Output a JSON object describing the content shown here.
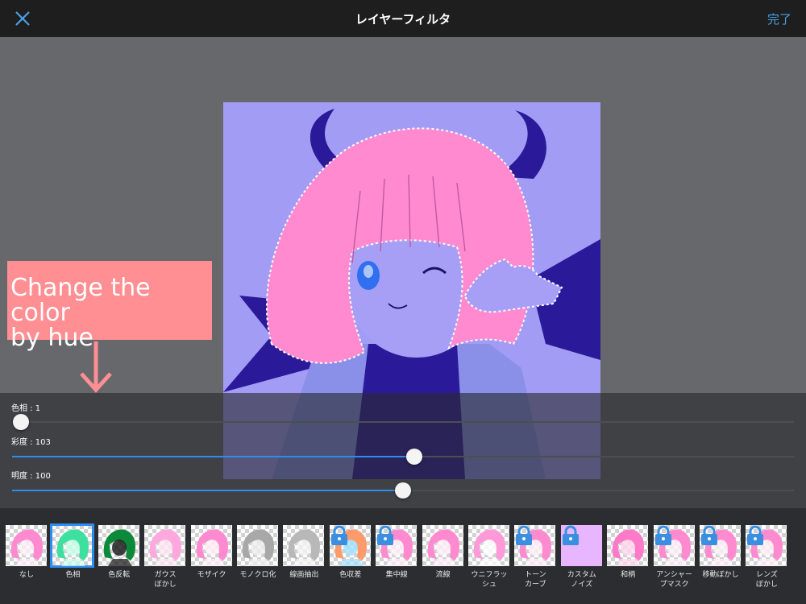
{
  "header": {
    "title": "レイヤーフィルタ",
    "done_label": "完了",
    "close_icon": "close-icon"
  },
  "annotation": {
    "text_line1": "Change the color",
    "text_line2": "by hue"
  },
  "sliders": [
    {
      "id": "hue",
      "label": "色相 : 1",
      "value": 1,
      "min": -180,
      "max": 180,
      "fraction": 0.011
    },
    {
      "id": "saturation",
      "label": "彩度 : 103",
      "value": 103,
      "fraction": 0.514
    },
    {
      "id": "brightness",
      "label": "明度 : 100",
      "value": 100,
      "fraction": 0.5
    }
  ],
  "filters": [
    {
      "label": "なし",
      "variant": "pink",
      "locked": false,
      "selected": false
    },
    {
      "label": "色相",
      "variant": "green",
      "locked": false,
      "selected": true
    },
    {
      "label": "色反転",
      "variant": "invert",
      "locked": false,
      "selected": false
    },
    {
      "label": "ガウス\nぼかし",
      "variant": "blur",
      "locked": false,
      "selected": false
    },
    {
      "label": "モザイク",
      "variant": "pink",
      "locked": false,
      "selected": false
    },
    {
      "label": "モノクロ化",
      "variant": "gray",
      "locked": false,
      "selected": false
    },
    {
      "label": "線画抽出",
      "variant": "lineart",
      "locked": false,
      "selected": false
    },
    {
      "label": "色収差",
      "variant": "rainbow",
      "locked": true,
      "selected": false
    },
    {
      "label": "集中線",
      "variant": "pink",
      "locked": true,
      "selected": false
    },
    {
      "label": "流線",
      "variant": "pink",
      "locked": false,
      "selected": false
    },
    {
      "label": "ウニフラッ\nシュ",
      "variant": "flash",
      "locked": false,
      "selected": false
    },
    {
      "label": "トーン\nカーブ",
      "variant": "pink",
      "locked": true,
      "selected": false
    },
    {
      "label": "カスタム\nノイズ",
      "variant": "solid",
      "locked": true,
      "selected": false
    },
    {
      "label": "和柄",
      "variant": "pattern",
      "locked": false,
      "selected": false
    },
    {
      "label": "アンシャー\nプマスク",
      "variant": "pink",
      "locked": true,
      "selected": false
    },
    {
      "label": "移動ぼかし",
      "variant": "pink",
      "locked": true,
      "selected": false
    },
    {
      "label": "レンズ\nぼかし",
      "variant": "pink",
      "locked": true,
      "selected": false
    }
  ],
  "colors": {
    "accent": "#2d8cf0",
    "done": "#4aa0e8",
    "annotation_bg": "#ff8f93",
    "hair_pink": "#ff8ad0",
    "horn": "#2a1a9a",
    "canvas_bg": "#a29cf5"
  }
}
